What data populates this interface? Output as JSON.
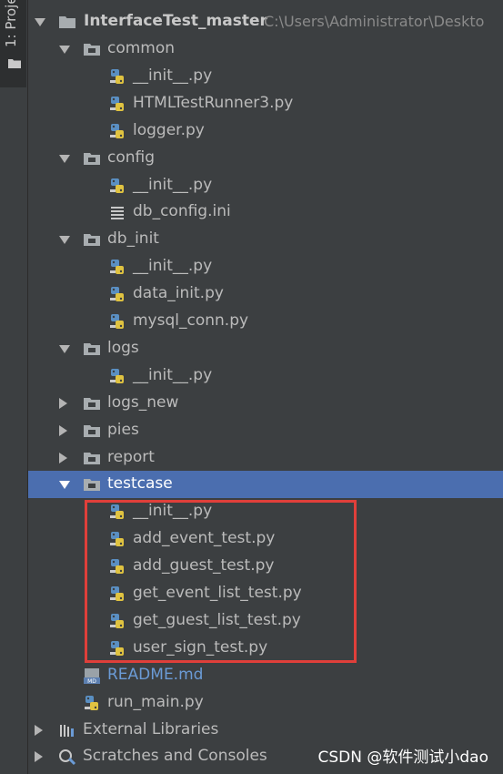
{
  "side_tab": {
    "label": "1: Proje"
  },
  "project": {
    "name": "InterfaceTest_master",
    "path": "C:\\Users\\Administrator\\Deskto"
  },
  "tree": [
    {
      "label": "common",
      "type": "folder",
      "state": "expanded"
    },
    {
      "label": "__init__.py",
      "type": "python"
    },
    {
      "label": "HTMLTestRunner3.py",
      "type": "python"
    },
    {
      "label": "logger.py",
      "type": "python"
    },
    {
      "label": "config",
      "type": "folder",
      "state": "expanded"
    },
    {
      "label": "__init__.py",
      "type": "python"
    },
    {
      "label": "db_config.ini",
      "type": "ini"
    },
    {
      "label": "db_init",
      "type": "folder",
      "state": "expanded"
    },
    {
      "label": "__init__.py",
      "type": "python"
    },
    {
      "label": "data_init.py",
      "type": "python"
    },
    {
      "label": "mysql_conn.py",
      "type": "python"
    },
    {
      "label": "logs",
      "type": "folder",
      "state": "expanded"
    },
    {
      "label": "__init__.py",
      "type": "python"
    },
    {
      "label": "logs_new",
      "type": "folder",
      "state": "collapsed"
    },
    {
      "label": "pies",
      "type": "folder",
      "state": "collapsed"
    },
    {
      "label": "report",
      "type": "folder",
      "state": "collapsed"
    },
    {
      "label": "testcase",
      "type": "folder",
      "state": "expanded",
      "selected": true
    },
    {
      "label": "__init__.py",
      "type": "python"
    },
    {
      "label": "add_event_test.py",
      "type": "python"
    },
    {
      "label": "add_guest_test.py",
      "type": "python"
    },
    {
      "label": "get_event_list_test.py",
      "type": "python"
    },
    {
      "label": "get_guest_list_test.py",
      "type": "python"
    },
    {
      "label": "user_sign_test.py",
      "type": "python"
    },
    {
      "label": "README.md",
      "type": "markdown",
      "icon_text": "MD"
    },
    {
      "label": "run_main.py",
      "type": "python"
    },
    {
      "label": "External Libraries",
      "type": "libraries",
      "state": "collapsed"
    },
    {
      "label": "Scratches and Consoles",
      "type": "scratches",
      "state": "collapsed"
    }
  ],
  "watermark": "CSDN @软件测试小dao",
  "colors": {
    "background": "#3c3f41",
    "selection": "#4b6eaf",
    "highlight": "#e03f3a",
    "text": "#bbbbbb"
  }
}
